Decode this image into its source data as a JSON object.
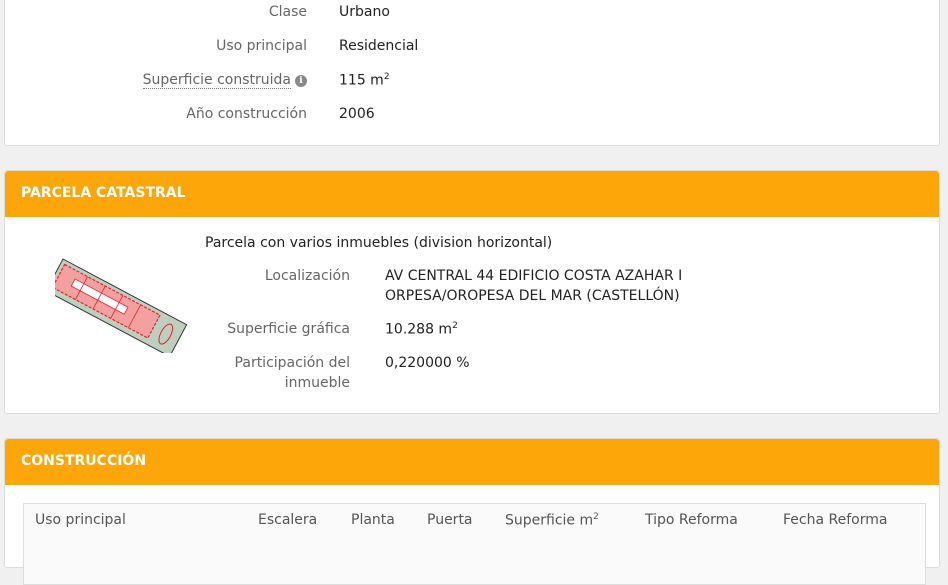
{
  "inmueble": {
    "rows": [
      {
        "label": "Clase",
        "value": "Urbano"
      },
      {
        "label": "Uso principal",
        "value": "Residencial"
      },
      {
        "label": "Superficie construida",
        "value": "115 m",
        "value_sup": "2"
      },
      {
        "label": "Año construcción",
        "value": "2006"
      }
    ],
    "info_icon": "info-icon"
  },
  "parcela": {
    "title": "PARCELA CATASTRAL",
    "subtitle": "Parcela con varios inmuebles (division horizontal)",
    "localizacion_label": "Localización",
    "localizacion_line1": "AV CENTRAL 44 EDIFICIO COSTA AZAHAR I",
    "localizacion_line2": "ORPESA/OROPESA DEL MAR (CASTELLÓN)",
    "superficie_label": "Superficie gráfica",
    "superficie_value": "10.288 m",
    "superficie_sup": "2",
    "participacion_label_1": "Participación del",
    "participacion_label_2": "inmueble",
    "participacion_value": "0,220000 %"
  },
  "construccion": {
    "title": "CONSTRUCCIÓN",
    "columns": [
      "Uso principal",
      "Escalera",
      "Planta",
      "Puerta",
      "Superficie m",
      "Tipo Reforma",
      "Fecha Reforma"
    ],
    "superficie_sup": "2"
  },
  "colors": {
    "header_bg": "#fca60a",
    "plan_red": "#e0232a",
    "plan_fill": "#bfcfbf"
  }
}
